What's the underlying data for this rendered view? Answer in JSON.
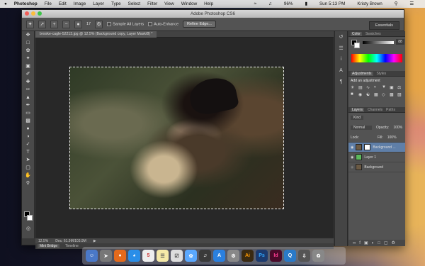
{
  "menubar": {
    "apple": "",
    "app": "Photoshop",
    "items": [
      "File",
      "Edit",
      "Image",
      "Layer",
      "Type",
      "Select",
      "Filter",
      "View",
      "Window",
      "Help"
    ],
    "battery": "96%",
    "clock": "Sun 5:13 PM",
    "user": "Kristy Brown"
  },
  "window": {
    "title": "Adobe Photoshop CS6"
  },
  "options": {
    "brush_size": "17",
    "sample_all": "Sample All Layers",
    "auto_enhance": "Auto-Enhance",
    "refine_btn": "Refine Edge...",
    "workspace": "Essentials"
  },
  "document": {
    "tab": "brooke-cagle-52213.jpg @ 12.5% (Background copy, Layer Mask/8) *",
    "zoom": "12.5%",
    "doc": "Doc: 61.9M/103.9M"
  },
  "bottom_tabs": {
    "mini_bridge": "Mini Bridge",
    "timeline": "Timeline"
  },
  "panels": {
    "color_tabs": [
      "Color",
      "Swatches"
    ],
    "color_value": "88",
    "adj_tabs": [
      "Adjustments",
      "Styles"
    ],
    "adj_title": "Add an adjustment",
    "layers_tabs": [
      "Layers",
      "Channels",
      "Paths"
    ],
    "kind": "Kind",
    "blend": "Normal",
    "opacity_label": "Opacity:",
    "opacity": "100%",
    "lock_label": "Lock:",
    "fill_label": "Fill:",
    "fill": "100%",
    "layers": [
      {
        "name": "Background ..."
      },
      {
        "name": "Layer 1"
      },
      {
        "name": "Background"
      }
    ]
  },
  "dock": {
    "ai": "Ai",
    "ps": "Ps",
    "id": "Id"
  },
  "colors": {
    "selected_layer": "#5f7fa8",
    "layer1_thumb": "#5cb85c",
    "ps_blue": "#1c3a6e"
  }
}
